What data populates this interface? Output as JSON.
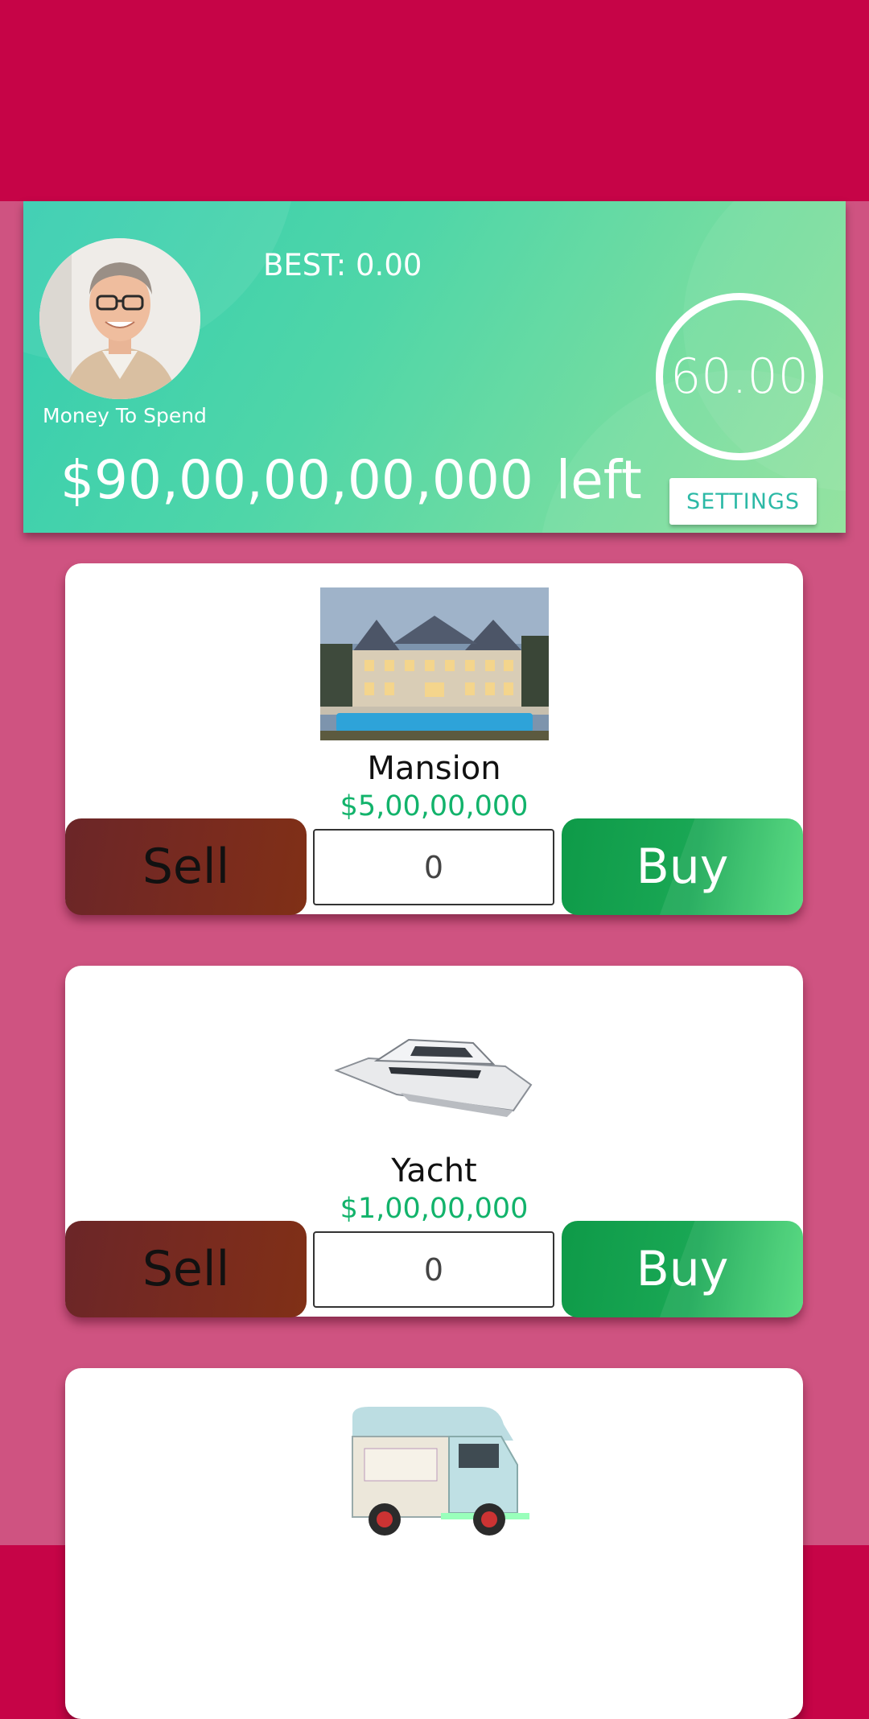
{
  "header": {
    "best_label": "BEST: 0.00",
    "money_label": "Money To Spend",
    "timer": "60.00",
    "money_amount": "$90,00,00,00,000",
    "money_suffix": "left",
    "settings_label": "SETTINGS"
  },
  "items": [
    {
      "name": "Mansion",
      "price": "$5,00,00,000",
      "quantity": "0",
      "sell_label": "Sell",
      "buy_label": "Buy",
      "image": "mansion-image"
    },
    {
      "name": "Yacht",
      "price": "$1,00,00,000",
      "quantity": "0",
      "sell_label": "Sell",
      "buy_label": "Buy",
      "image": "yacht-image"
    },
    {
      "image": "food-truck-image"
    }
  ],
  "colors": {
    "top_bar": "#c60447",
    "background": "#cf5381",
    "header_gradient_start": "#35cdb0",
    "header_gradient_end": "#8ee29b",
    "price_green": "#12b36b",
    "buy_green": "#1aa855",
    "sell_brown": "#7a2b1e"
  }
}
